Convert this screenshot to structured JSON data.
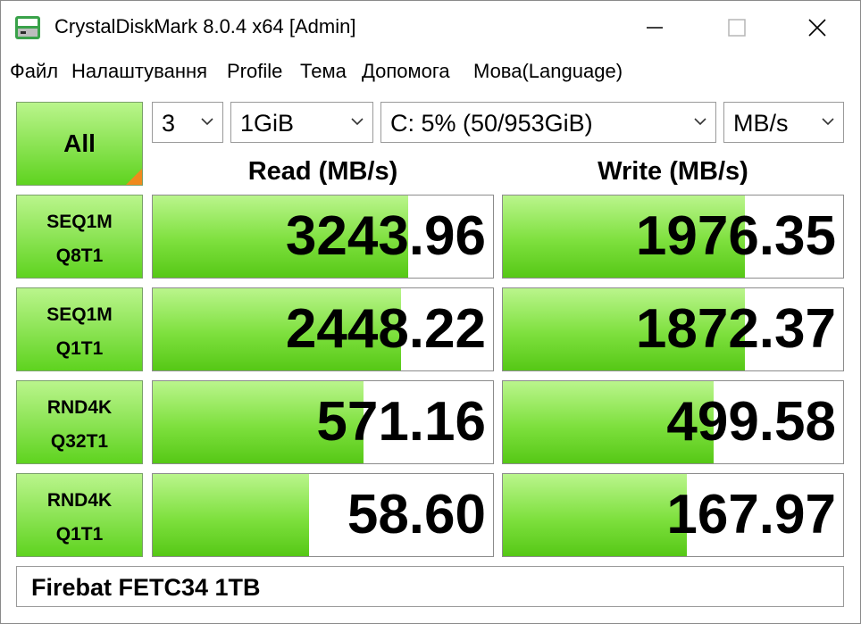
{
  "window": {
    "title": "CrystalDiskMark 8.0.4 x64 [Admin]"
  },
  "menu": [
    "Файл",
    "Налаштування",
    "Profile",
    "Тема",
    "Допомога",
    "Мова(Language)"
  ],
  "controls": {
    "all_label": "All",
    "count": "3",
    "size": "1GiB",
    "drive": "C: 5% (50/953GiB)",
    "unit": "MB/s"
  },
  "headers": {
    "read": "Read (MB/s)",
    "write": "Write (MB/s)"
  },
  "tests": [
    {
      "line1": "SEQ1M",
      "line2": "Q8T1",
      "read": "3243.96",
      "write": "1976.35",
      "read_fill": 0.75,
      "write_fill": 0.71
    },
    {
      "line1": "SEQ1M",
      "line2": "Q1T1",
      "read": "2448.22",
      "write": "1872.37",
      "read_fill": 0.73,
      "write_fill": 0.71
    },
    {
      "line1": "RND4K",
      "line2": "Q32T1",
      "read": "571.16",
      "write": "499.58",
      "read_fill": 0.62,
      "write_fill": 0.62
    },
    {
      "line1": "RND4K",
      "line2": "Q1T1",
      "read": "58.60",
      "write": "167.97",
      "read_fill": 0.46,
      "write_fill": 0.54
    }
  ],
  "status": {
    "text": "Firebat FETC34 1TB"
  },
  "colors": {
    "accent_green": "#5fd31f",
    "corner_orange": "#f08a1d"
  }
}
